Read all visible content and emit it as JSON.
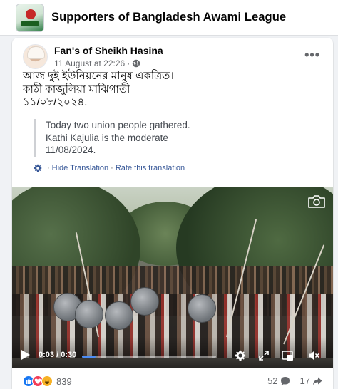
{
  "group": {
    "name": "Supporters of Bangladesh Awami League"
  },
  "post": {
    "author": "Fan's of Sheikh Hasina",
    "timestamp": "11 August at 22:26",
    "separator": "·",
    "privacy_icon": "globe-icon",
    "original_text": [
      "আজ দুই ইউনিয়নের মানুষ একত্রিত।",
      "কাঠী কাজুলিয়া মাঝিগাতী",
      "১১/০৮/২০২৪."
    ],
    "translation": [
      "Today two union people gathered.",
      "Kathi Kajulia is the moderate",
      "11/08/2024."
    ],
    "translation_links": {
      "hide": "Hide Translation",
      "rate": "Rate this translation",
      "dot": "·"
    }
  },
  "video": {
    "current_time": "0:03",
    "duration": "0:30",
    "time_separator": " / ",
    "progress_fraction": 0.1
  },
  "engagement": {
    "reactions": [
      "like",
      "love",
      "haha"
    ],
    "reaction_count": "839",
    "comment_count": "52",
    "share_count": "17"
  },
  "colors": {
    "link": "#385898",
    "like": "#1877f2",
    "love": "#f33e58",
    "haha": "#f7b125",
    "progress": "#4b8cf5"
  }
}
